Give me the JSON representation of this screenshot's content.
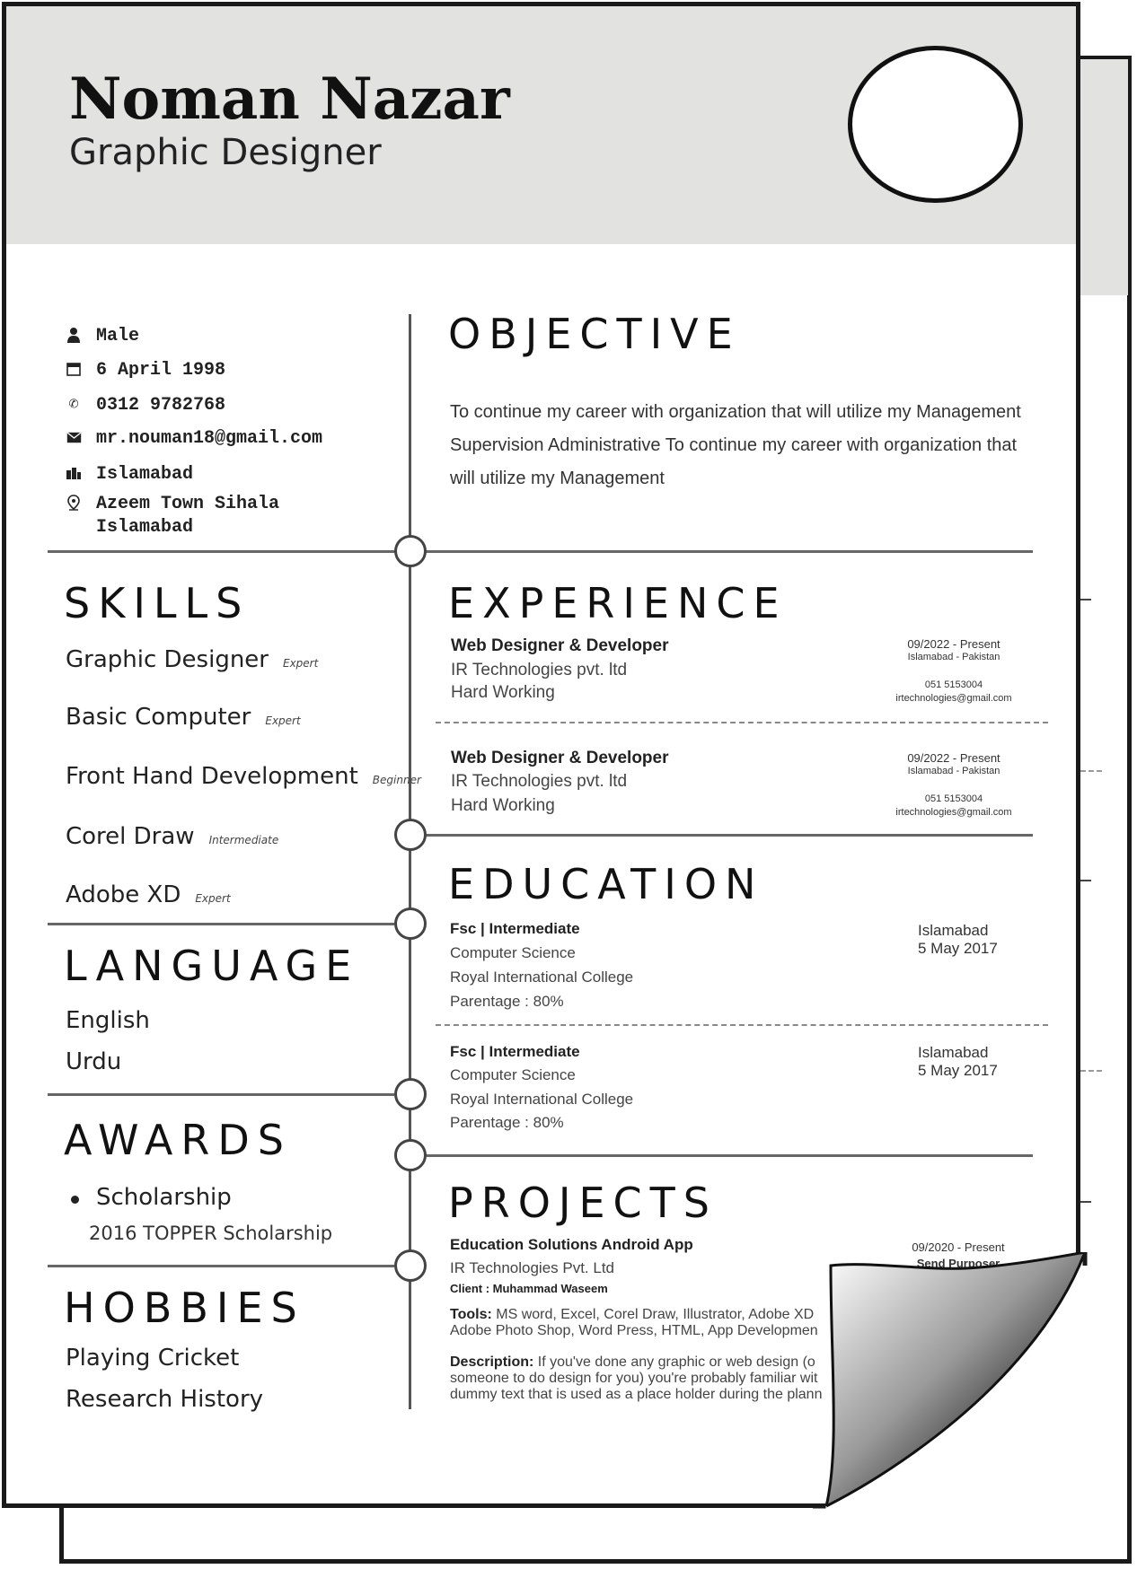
{
  "header": {
    "name": "Noman Nazar",
    "role": "Graphic Designer"
  },
  "contact": [
    {
      "icon": "user-icon",
      "text": "Male"
    },
    {
      "icon": "calendar-icon",
      "text": "6 April 1998"
    },
    {
      "icon": "phone-icon",
      "text": "0312 9782768"
    },
    {
      "icon": "mail-icon",
      "text": "mr.nouman18@gmail.com"
    },
    {
      "icon": "city-icon",
      "text": "Islamabad"
    },
    {
      "icon": "location-pin-icon",
      "text": "Azeem Town Sihala\nIslamabad"
    }
  ],
  "skills": {
    "title": "SKILLS",
    "items": [
      {
        "name": "Graphic Designer",
        "level": "Expert"
      },
      {
        "name": "Basic Computer",
        "level": "Expert"
      },
      {
        "name": "Front Hand Development",
        "level": "Beginner"
      },
      {
        "name": "Corel Draw",
        "level": "Intermediate"
      },
      {
        "name": "Adobe XD",
        "level": "Expert"
      }
    ]
  },
  "language": {
    "title": "LANGUAGE",
    "items": [
      "English",
      "Urdu"
    ]
  },
  "awards": {
    "title": "AWARDS",
    "name": "Scholarship",
    "detail": "2016 TOPPER Scholarship"
  },
  "hobbies": {
    "title": "HOBBIES",
    "items": [
      "Playing Cricket",
      "Research History"
    ]
  },
  "objective": {
    "title": "OBJECTIVE",
    "text": "To continue my career with organization that will utilize my Management Supervision Administrative To continue my career with organization that will utilize my Management"
  },
  "experience": {
    "title": "EXPERIENCE",
    "items": [
      {
        "title": "Web Designer & Developer",
        "company": "IR Technologies pvt. ltd",
        "note": "Hard Working",
        "dates": "09/2022 - Present",
        "location": "Islamabad - Pakistan",
        "phone": "051 5153004",
        "email": "irtechnologies@gmail.com"
      },
      {
        "title": "Web Designer & Developer",
        "company": "IR Technologies pvt. ltd",
        "note": "Hard Working",
        "dates": "09/2022 - Present",
        "location": "Islamabad - Pakistan",
        "phone": "051 5153004",
        "email": "irtechnologies@gmail.com"
      }
    ]
  },
  "education": {
    "title": "EDUCATION",
    "items": [
      {
        "degree": "Fsc | Intermediate",
        "field": "Computer Science",
        "school": "Royal International College",
        "grade": "Parentage : 80%",
        "city": "Islamabad",
        "date": "5 May 2017"
      },
      {
        "degree": "Fsc | Intermediate",
        "field": "Computer Science",
        "school": "Royal International College",
        "grade": "Parentage : 80%",
        "city": "Islamabad",
        "date": "5 May 2017"
      }
    ]
  },
  "projects": {
    "title": "PROJECTS",
    "name": "Education Solutions Android App",
    "company": "IR Technologies Pvt. Ltd",
    "client": "Client : Muhammad Waseem",
    "dates": "09/2020 - Present",
    "status": "Send Purposer",
    "tools_label": "Tools:",
    "tools": "MS word, Excel, Corel Draw, Illustrator, Adobe XD Adobe Photo Shop, Word Press, HTML, App Developmen",
    "desc_label": "Description:",
    "desc": "If you've done any graphic or web design (o someone to do design for you) you're probably familiar wit dummy text that is used as a place holder during the plann"
  }
}
